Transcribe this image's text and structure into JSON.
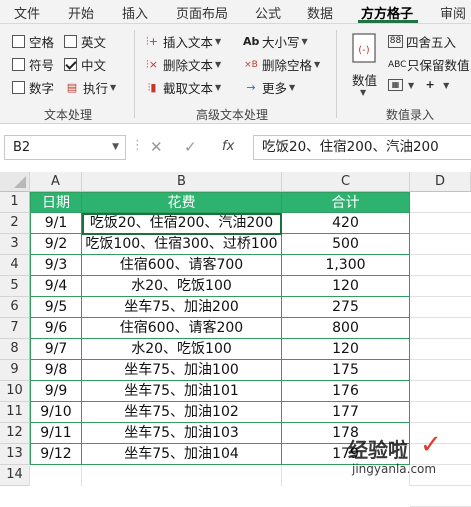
{
  "menu": {
    "tabs": [
      "文件",
      "开始",
      "插入",
      "页面布局",
      "公式",
      "数据",
      "方方格子",
      "审阅"
    ],
    "active": "方方格子"
  },
  "ribbon": {
    "text_processing": {
      "items": [
        {
          "label": "空格",
          "checked": false
        },
        {
          "label": "英文",
          "checked": false
        },
        {
          "label": "符号",
          "checked": false
        },
        {
          "label": "中文",
          "checked": true
        },
        {
          "label": "数字",
          "checked": false
        }
      ],
      "execute_label": "执行",
      "group_label": "文本处理"
    },
    "advanced_text": {
      "insert_text": "插入文本",
      "delete_text": "删除文本",
      "extract_text": "截取文本",
      "case": "大小写",
      "delete_space": "删除空格",
      "more": "更多",
      "group_label": "高级文本处理"
    },
    "numeric": {
      "value_label": "数值",
      "round_label": "四舍五入",
      "keep_value_label": "只保留数值",
      "group_label": "数值录入"
    }
  },
  "formula_bar": {
    "name_box": "B2",
    "formula": "吃饭20、住宿200、汽油200",
    "fx": "fx"
  },
  "sheet": {
    "columns": [
      "A",
      "B",
      "C",
      "D"
    ],
    "rows": [
      "1",
      "2",
      "3",
      "4",
      "5",
      "6",
      "7",
      "8",
      "9",
      "10",
      "11",
      "12",
      "13",
      "14"
    ],
    "header": [
      "日期",
      "花费",
      "合计"
    ],
    "data": [
      [
        "9/1",
        "吃饭20、住宿200、汽油200",
        "420"
      ],
      [
        "9/2",
        "吃饭100、住宿300、过桥100",
        "500"
      ],
      [
        "9/3",
        "住宿600、请客700",
        "1,300"
      ],
      [
        "9/4",
        "水20、吃饭100",
        "120"
      ],
      [
        "9/5",
        "坐车75、加油200",
        "275"
      ],
      [
        "9/6",
        "住宿600、请客200",
        "800"
      ],
      [
        "9/7",
        "水20、吃饭100",
        "120"
      ],
      [
        "9/8",
        "坐车75、加油100",
        "175"
      ],
      [
        "9/9",
        "坐车75、加油101",
        "176"
      ],
      [
        "9/10",
        "坐车75、加油102",
        "177"
      ],
      [
        "9/11",
        "坐车75、加油103",
        "178"
      ],
      [
        "9/12",
        "坐车75、加油104",
        "179"
      ]
    ]
  },
  "watermark": {
    "line1": "经验啦",
    "line2": "jingyanla.com"
  },
  "colors": {
    "accent": "#217346",
    "header_fill": "#2db36f",
    "border": "#2f9e5f"
  }
}
